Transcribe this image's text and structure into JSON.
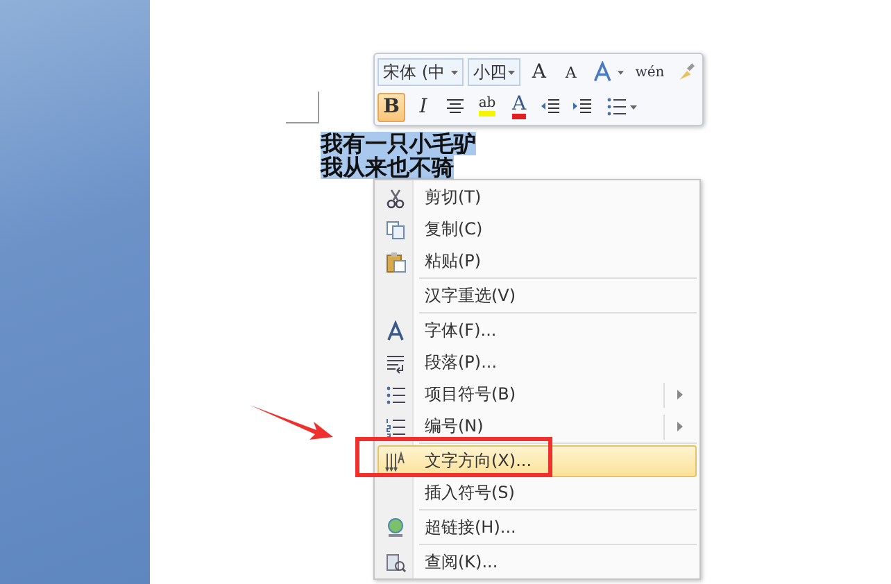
{
  "document": {
    "lines": [
      {
        "text": "我有一只小毛驴"
      },
      {
        "text": "我从来也不骑"
      }
    ]
  },
  "mini_toolbar": {
    "font": "宋体 (中",
    "size": "小四",
    "row1": [
      {
        "kind": "grow",
        "label": "A"
      },
      {
        "kind": "shrink",
        "label": "A"
      },
      {
        "kind": "styles"
      },
      {
        "kind": "phonetic",
        "label": "wén"
      },
      {
        "kind": "brush"
      }
    ],
    "row2": [
      {
        "kind": "bold",
        "label": "B",
        "selected": true
      },
      {
        "kind": "italic",
        "label": "I",
        "selected": false
      },
      {
        "kind": "center"
      },
      {
        "kind": "highlight",
        "label": "ab"
      },
      {
        "kind": "fontcolor",
        "label": "A"
      },
      {
        "kind": "outdent"
      },
      {
        "kind": "indent"
      },
      {
        "kind": "bullets"
      }
    ]
  },
  "context_menu": [
    {
      "kind": "scissors",
      "label": "剪切(T)",
      "submenu": false,
      "highlighted": false
    },
    {
      "kind": "copy",
      "label": "复制(C)",
      "submenu": false,
      "highlighted": false
    },
    {
      "kind": "paste",
      "label": "粘贴(P)",
      "submenu": false,
      "highlighted": false
    },
    {
      "kind": "separator"
    },
    {
      "kind": "plain",
      "label": "汉字重选(V)",
      "submenu": false,
      "highlighted": false
    },
    {
      "kind": "separator"
    },
    {
      "kind": "font",
      "label": "字体(F)...",
      "submenu": false,
      "highlighted": false
    },
    {
      "kind": "paragraph",
      "label": "段落(P)...",
      "submenu": false,
      "highlighted": false
    },
    {
      "kind": "bullets",
      "label": "项目符号(B)",
      "submenu": true,
      "highlighted": false
    },
    {
      "kind": "numbering",
      "label": "编号(N)",
      "submenu": true,
      "highlighted": false
    },
    {
      "kind": "separator"
    },
    {
      "kind": "direction",
      "label": "文字方向(X)...",
      "submenu": false,
      "highlighted": true
    },
    {
      "kind": "plain",
      "label": "插入符号(S)",
      "submenu": false,
      "highlighted": false
    },
    {
      "kind": "separator"
    },
    {
      "kind": "globe",
      "label": "超链接(H)...",
      "submenu": false,
      "highlighted": false
    },
    {
      "kind": "separator"
    },
    {
      "kind": "lookup",
      "label": "查阅(K)...",
      "submenu": false,
      "highlighted": false
    }
  ]
}
